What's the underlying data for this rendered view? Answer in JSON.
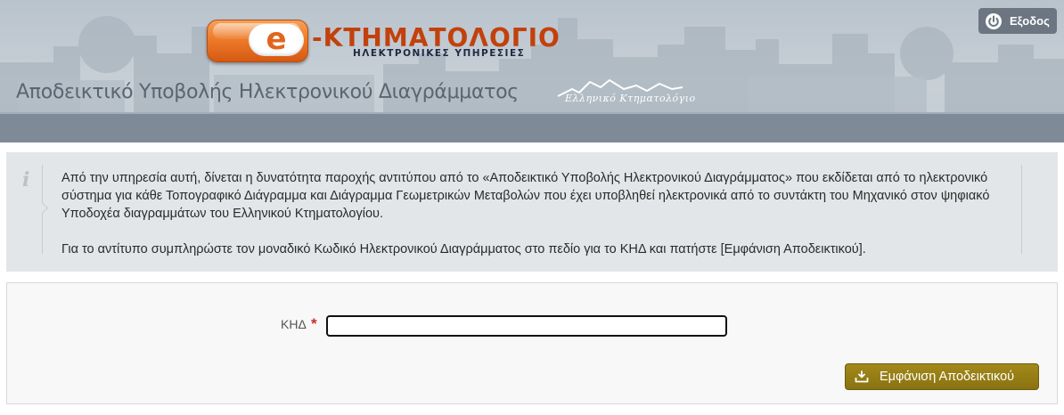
{
  "header": {
    "logo_letter": "e",
    "logo_title": "-ΚΤΗΜΑΤΟΛΟΓΙΟ",
    "logo_subtitle": "ΗΛΕΚΤΡΟΝΙΚΕΣ ΥΠΗΡΕΣΙΕΣ",
    "org_name": "Ελληνικό Κτηματολόγιο",
    "page_title": "Αποδεικτικό Υποβολής Ηλεκτρονικού Διαγράμματος",
    "logout_label": "Εξοδος",
    "logout_icon": "power-icon",
    "colors": {
      "header_band": "#7e8a97",
      "logo_orange": "#ee7b2a"
    }
  },
  "info": {
    "icon": "info-icon",
    "icon_glyph": "i",
    "paragraph1": "Από την υπηρεσία αυτή, δίνεται η δυνατότητα παροχής αντιτύπου από το «Αποδεικτικό Υποβολής Ηλεκτρονικού Διαγράμματος» που εκδίδεται από το ηλεκτρονικό σύστημα για κάθε Τοπογραφικό Διάγραμμα και Διάγραμμα Γεωμετρικών Μεταβολών που έχει υποβληθεί ηλεκτρονικά από το συντάκτη του Μηχανικό στον ψηφιακό Υποδοχέα διαγραμμάτων του Ελληνικού Κτηματολογίου.",
    "paragraph2": "Για το αντίτυπο συμπληρώστε τον μοναδικό Κωδικό Ηλεκτρονικού Διαγράμματος στο πεδίο για το ΚΗΔ και πατήστε [Εμφάνιση Αποδεικτικού]."
  },
  "form": {
    "kid_label": "ΚΗΔ",
    "required_mark": "*",
    "kid_value": "",
    "show_button_label": "Εμφάνιση Αποδεικτικού",
    "show_button_icon": "download-icon",
    "colors": {
      "button": "#967e15",
      "required": "#cc2b2b"
    }
  }
}
